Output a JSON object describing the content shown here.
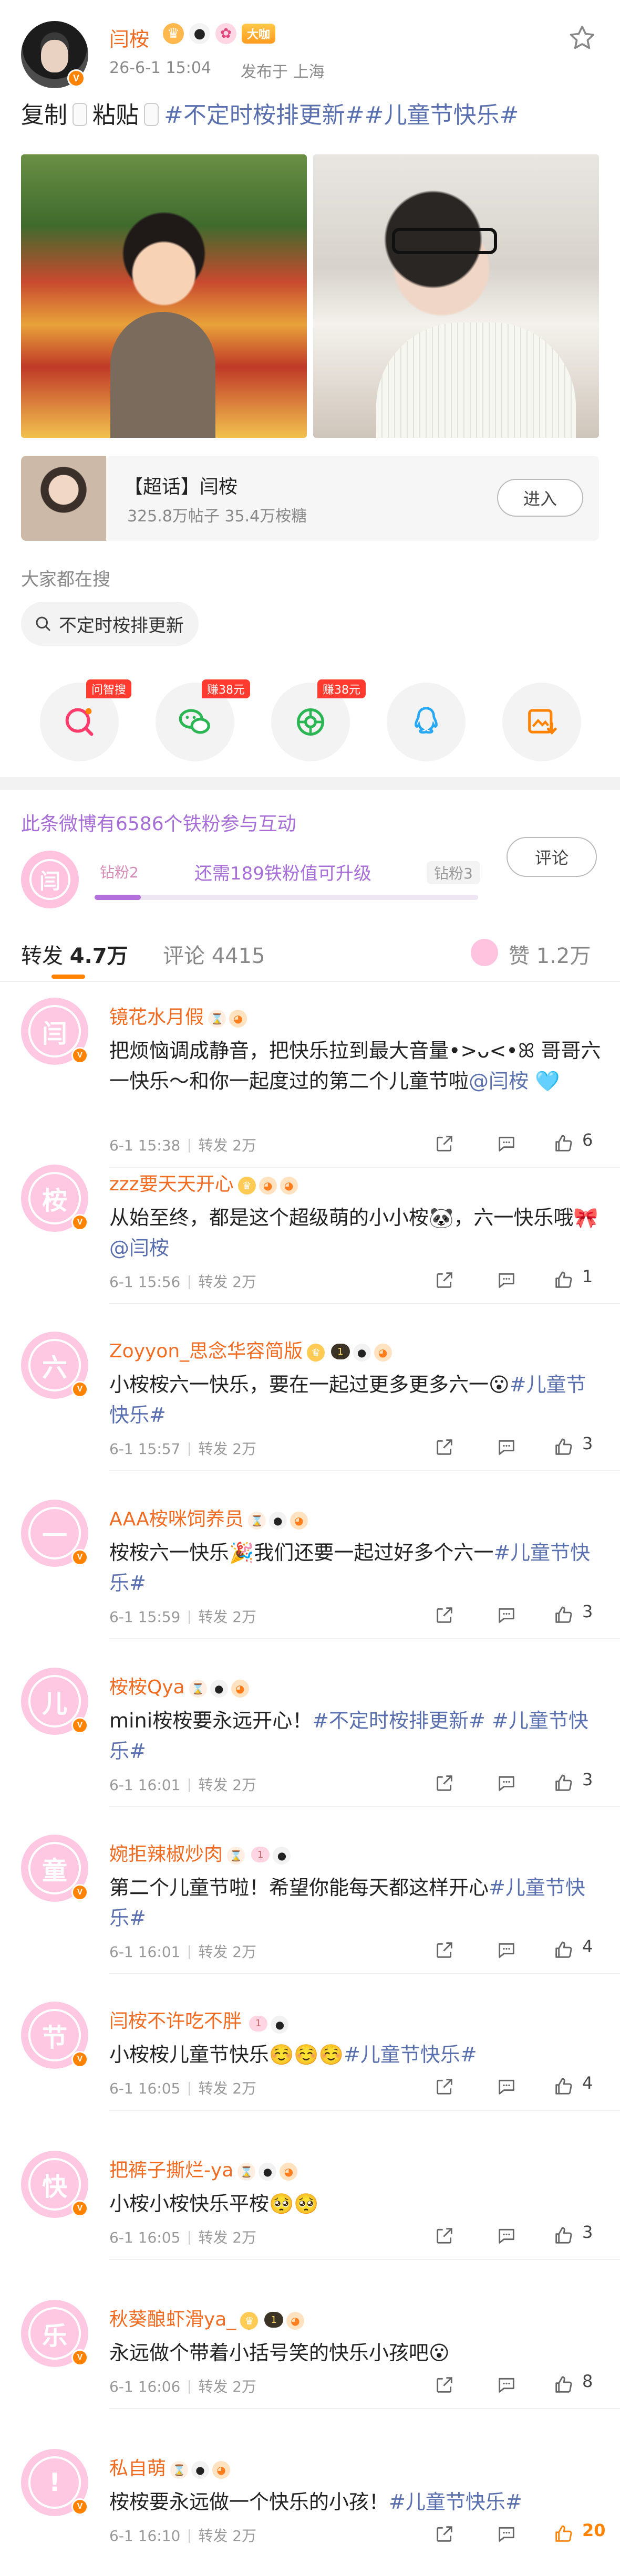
{
  "post": {
    "author": "闫桉",
    "level_badge": "大咖",
    "time": "26-6-1 15:04",
    "location": "发布于 上海",
    "text_prefix_1": "复制",
    "text_prefix_2": "粘贴",
    "hashtags": "#不定时桉排更新##儿童节快乐#"
  },
  "topic_card": {
    "title": "【超话】闫桉",
    "stats": "325.8万帖子 35.4万桉糖",
    "enter_label": "进入"
  },
  "search": {
    "label": "大家都在搜",
    "chip": "不定时桉排更新"
  },
  "share": {
    "badges": [
      "问智搜",
      "赚38元",
      "赚38元"
    ],
    "icons": [
      "ask-search-icon",
      "wechat-icon",
      "moments-icon",
      "qq-icon",
      "save-image-icon"
    ]
  },
  "interaction": {
    "text": "此条微博有6586个铁粉参与互动",
    "comment_label": "评论",
    "fan_avatar_char": "闫",
    "level_from": "钻粉2",
    "level_to": "钻粉3",
    "progress_text": "还需189铁粉值可升级",
    "progress": 0.12
  },
  "tabs": {
    "repost_label": "转发",
    "repost_count": "4.7万",
    "comment_label": "评论",
    "comment_count": "4415",
    "like_label": "赞",
    "like_count": "1.2万"
  },
  "comments": [
    {
      "avatar_char": "闫",
      "name": "镜花水月假",
      "text": "把烦恼调成静音，把快乐拉到最大音量•>ᴗ<•ꕤ 哥哥六一快乐～和你一起度过的第二个儿童节啦@闫桉 🩵",
      "time": "6-1 15:38",
      "repost": "转发 2万",
      "likes": "6"
    },
    {
      "avatar_char": "桉",
      "name": "zzz要天天开心",
      "text": "从始至终，都是这个超级萌的小小桉🐼，六一快乐哦🎀@闫桉",
      "time": "6-1 15:56",
      "repost": "转发 2万",
      "likes": "1"
    },
    {
      "avatar_char": "六",
      "name": "Zoyyon_思念华容简版",
      "text": "小桉桉六一快乐，要在一起过更多更多六一😮#儿童节快乐#",
      "time": "6-1 15:57",
      "repost": "转发 2万",
      "likes": "3"
    },
    {
      "avatar_char": "一",
      "name": "AAA桉咪饲养员",
      "text": "桉桉六一快乐🎉我们还要一起过好多个六一#儿童节快乐#",
      "time": "6-1 15:59",
      "repost": "转发 2万",
      "likes": "3"
    },
    {
      "avatar_char": "儿",
      "name": "桉桉Qya",
      "text": "mini桉桉要永远开心！#不定时桉排更新# #儿童节快乐#",
      "time": "6-1 16:01",
      "repost": "转发 2万",
      "likes": "3"
    },
    {
      "avatar_char": "童",
      "name": "婉拒辣椒炒肉",
      "text": "第二个儿童节啦！希望你能每天都这样开心#儿童节快乐#",
      "time": "6-1 16:01",
      "repost": "转发 2万",
      "likes": "4"
    },
    {
      "avatar_char": "节",
      "name": "闫桉不许吃不胖",
      "text": "小桉桉儿童节快乐☺️☺️☺️#儿童节快乐#",
      "time": "6-1 16:05",
      "repost": "转发 2万",
      "likes": "4"
    },
    {
      "avatar_char": "快",
      "name": "把裤子撕烂-ya",
      "text": "小桉小桉快乐平桉🥺🥺",
      "time": "6-1 16:05",
      "repost": "转发 2万",
      "likes": "3"
    },
    {
      "avatar_char": "乐",
      "name": "秋葵酿虾滑ya_",
      "text": "永远做个带着小括号笑的快乐小孩吧😮",
      "time": "6-1 16:06",
      "repost": "转发 2万",
      "likes": "8"
    },
    {
      "avatar_char": "!",
      "name": "私自萌",
      "text": "桉桉要永远做一个快乐的小孩！#儿童节快乐#",
      "time": "6-1 16:10",
      "repost": "转发 2万",
      "likes": "20"
    }
  ],
  "colors": {
    "accent": "#ff8200",
    "username": "#f06c22",
    "hashtag": "#5a6fae",
    "fan_purple": "#a66ed6"
  }
}
